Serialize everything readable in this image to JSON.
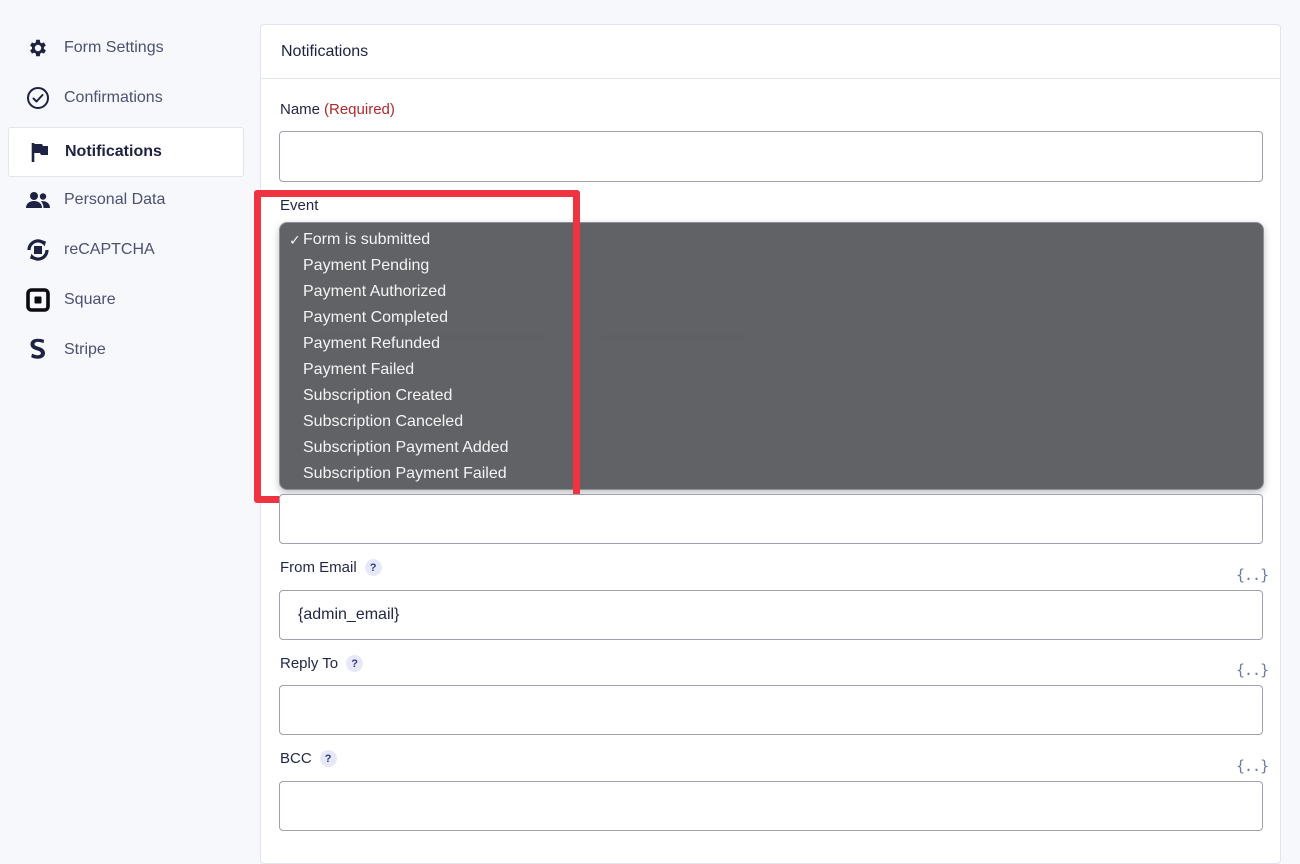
{
  "sidebar": {
    "items": [
      {
        "label": "Form Settings",
        "icon": "gear-icon"
      },
      {
        "label": "Confirmations",
        "icon": "check-circle-icon"
      },
      {
        "label": "Notifications",
        "icon": "flag-icon",
        "active": true
      },
      {
        "label": "Personal Data",
        "icon": "users-icon"
      },
      {
        "label": "reCAPTCHA",
        "icon": "recaptcha-icon"
      },
      {
        "label": "Square",
        "icon": "square-icon"
      },
      {
        "label": "Stripe",
        "icon": "stripe-icon"
      }
    ]
  },
  "panel": {
    "title": "Notifications",
    "name_label": "Name",
    "name_required": "(Required)",
    "name_value": "",
    "event_label": "Event",
    "event_selected": "Form is submitted",
    "event_options": [
      "Form is submitted",
      "Payment Pending",
      "Payment Authorized",
      "Payment Completed",
      "Payment Refunded",
      "Payment Failed",
      "Subscription Created",
      "Subscription Canceled",
      "Subscription Payment Added",
      "Subscription Payment Failed"
    ],
    "check_mark": "✓",
    "from_email_label": "From Email",
    "from_email_value": "{admin_email}",
    "reply_to_label": "Reply To",
    "reply_to_value": "",
    "bcc_label": "BCC",
    "bcc_value": "",
    "help_glyph": "?",
    "merge_tag_glyph": "{..}"
  },
  "colors": {
    "highlight": "#ef3340",
    "required": "#b0292c",
    "dropdown_bg": "#55565a"
  }
}
